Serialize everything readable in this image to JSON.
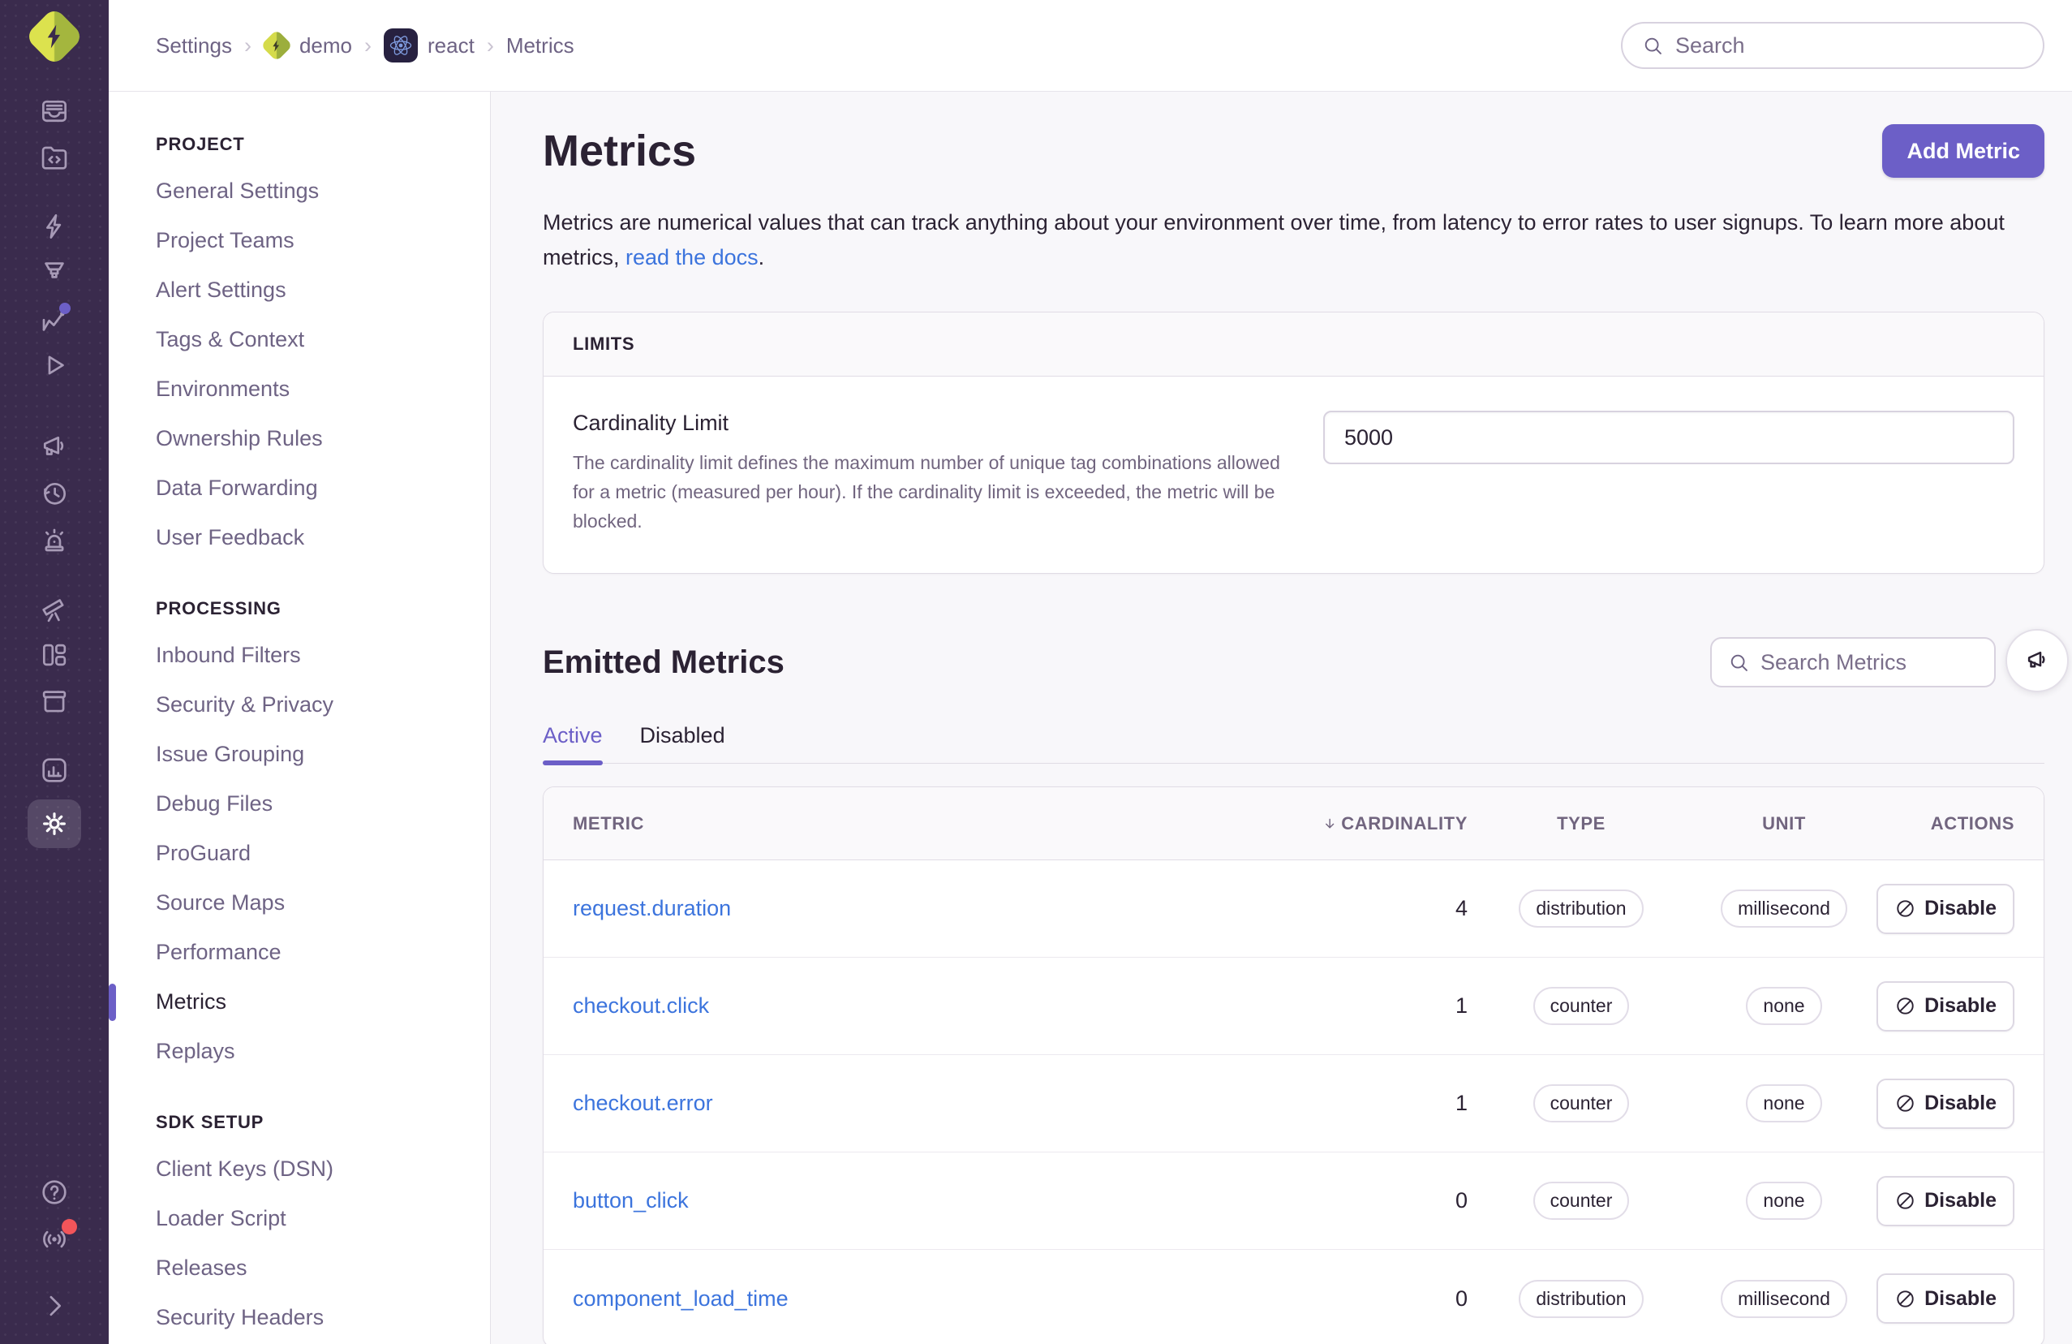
{
  "colors": {
    "sidebar_bg": "#3A2B4D",
    "accent_purple": "#6C5FC7",
    "link_blue": "#3C74DD",
    "text_dark": "#2B2233",
    "text_muted": "#6E6384",
    "border": "#E0DCE5",
    "page_bg": "#F8F7FA",
    "logo_lime": "#DCE24E",
    "logo_olive": "#A4B63E",
    "react_blue": "#7F9CDF",
    "badge_red": "#F2555A"
  },
  "rail": {
    "icons": [
      "inbox-issues",
      "code-folder",
      "lightning",
      "funnel",
      "insights-chart",
      "play-replays",
      "megaphone",
      "history-clock",
      "siren-alerts",
      "telescope",
      "layout-board",
      "archive-box",
      "stats-chart",
      "settings-gear"
    ],
    "active_icon": "settings-gear",
    "badges": {
      "insights-chart": "purple-dot",
      "whats-new": "red-dot"
    },
    "bottom_icons": [
      "help",
      "whats-new-broadcast",
      "collapse-chevron"
    ]
  },
  "topbar": {
    "separator": "›",
    "breadcrumb": [
      {
        "label": "Settings"
      },
      {
        "label": "demo",
        "icon": "demo-project"
      },
      {
        "label": "react",
        "icon": "react-project"
      },
      {
        "label": "Metrics"
      }
    ],
    "search_placeholder": "Search"
  },
  "subnav": {
    "sections": [
      {
        "title": "PROJECT",
        "items": [
          "General Settings",
          "Project Teams",
          "Alert Settings",
          "Tags & Context",
          "Environments",
          "Ownership Rules",
          "Data Forwarding",
          "User Feedback"
        ]
      },
      {
        "title": "PROCESSING",
        "items": [
          "Inbound Filters",
          "Security & Privacy",
          "Issue Grouping",
          "Debug Files",
          "ProGuard",
          "Source Maps",
          "Performance",
          "Metrics",
          "Replays"
        ],
        "active_item": "Metrics"
      },
      {
        "title": "SDK SETUP",
        "items": [
          "Client Keys (DSN)",
          "Loader Script",
          "Releases",
          "Security Headers"
        ]
      }
    ]
  },
  "main": {
    "title": "Metrics",
    "add_button_label": "Add Metric",
    "description_before": "Metrics are numerical values that can track anything about your environment over time, from latency to error rates to user signups. To learn more about metrics, ",
    "description_link": "read the docs",
    "description_after": ".",
    "limits": {
      "header": "LIMITS",
      "field_label": "Cardinality Limit",
      "field_help": "The cardinality limit defines the maximum number of unique tag combinations allowed for a metric (measured per hour). If the cardinality limit is exceeded, the metric will be blocked.",
      "value": "5000"
    },
    "emitted": {
      "title": "Emitted Metrics",
      "search_placeholder": "Search Metrics",
      "tabs": [
        {
          "label": "Active",
          "active": true
        },
        {
          "label": "Disabled",
          "active": false
        }
      ]
    },
    "table": {
      "columns": {
        "metric": "METRIC",
        "cardinality": "CARDINALITY",
        "type": "TYPE",
        "unit": "UNIT",
        "actions": "ACTIONS"
      },
      "sort": {
        "column": "CARDINALITY",
        "direction": "desc"
      },
      "rows": [
        {
          "metric": "request.duration",
          "cardinality": "4",
          "type": "distribution",
          "unit": "millisecond",
          "action": "Disable"
        },
        {
          "metric": "checkout.click",
          "cardinality": "1",
          "type": "counter",
          "unit": "none",
          "action": "Disable"
        },
        {
          "metric": "checkout.error",
          "cardinality": "1",
          "type": "counter",
          "unit": "none",
          "action": "Disable"
        },
        {
          "metric": "button_click",
          "cardinality": "0",
          "type": "counter",
          "unit": "none",
          "action": "Disable"
        },
        {
          "metric": "component_load_time",
          "cardinality": "0",
          "type": "distribution",
          "unit": "millisecond",
          "action": "Disable"
        }
      ]
    }
  }
}
